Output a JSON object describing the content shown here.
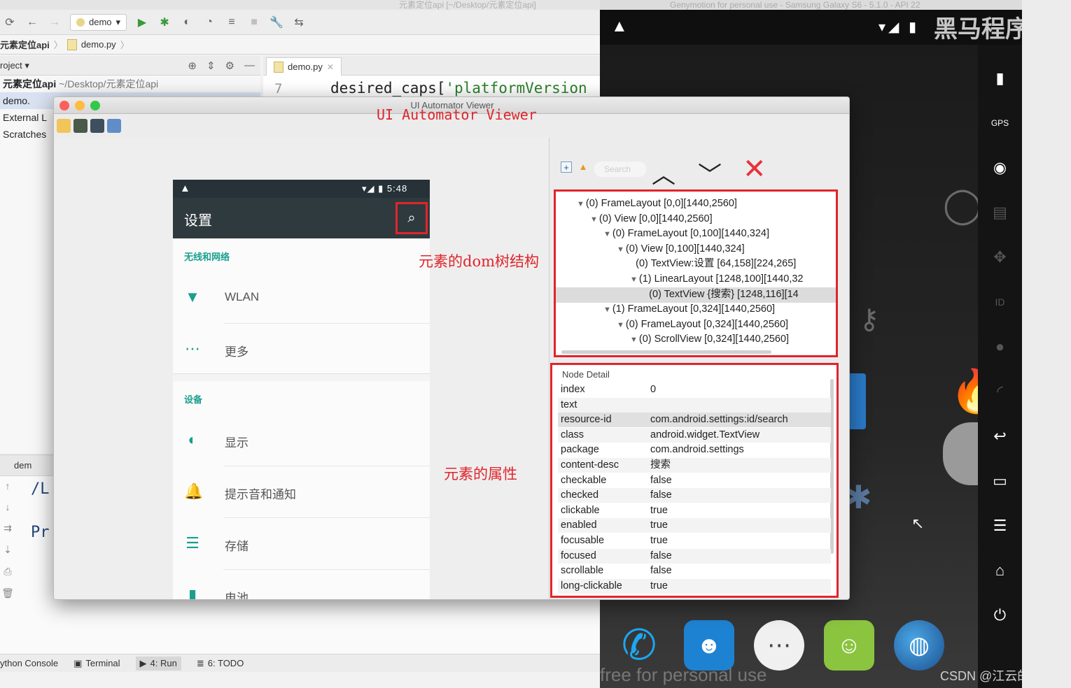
{
  "ide": {
    "title_text": "元素定位api [~/Desktop/元素定位api]",
    "run_config": "demo",
    "breadcrumb": [
      "元素定位api",
      "demo.py"
    ],
    "project_header": "roject",
    "project_rows": [
      {
        "strong": "元素定位api",
        "muted": "~/Desktop/元素定位api"
      },
      {
        "strong": "demo.",
        "muted": ""
      },
      {
        "strong": "External L",
        "muted": ""
      },
      {
        "strong": "Scratches",
        "muted": ""
      }
    ],
    "editor_tab": "demo.py",
    "line_number": "7",
    "code_prefix": "desired_caps[",
    "code_string": "'platformVersion",
    "run_tab": "dem",
    "run_lines": [
      "/L",
      "Pr"
    ],
    "status_tabs": [
      "ython Console",
      "Terminal",
      "4: Run",
      "6: TODO"
    ]
  },
  "emulator": {
    "title_text": "Genymotion for personal use - Samsung Galaxy S6 - 5.1.0 - API 22",
    "signal_text": "▾◢ ▮",
    "watermark": "黑马程序员",
    "free_text": "free for personal use",
    "csdn_text": "CSDN @江云的博客",
    "side_buttons": [
      "battery-icon",
      "gps-icon",
      "camera-icon",
      "video-icon",
      "dpad-icon",
      "id-icon",
      "identity-icon",
      "rss-icon",
      "back-icon",
      "recent-apps-icon",
      "menu-icon",
      "home-icon",
      "power-icon"
    ]
  },
  "uiav": {
    "window_title": "UI Automator Viewer",
    "search_placeholder": "Search",
    "screen": {
      "time": "5:48",
      "title": "设置",
      "category_wireless": "无线和网络",
      "category_device": "设备",
      "items_wireless": [
        "WLAN",
        "更多"
      ],
      "items_device": [
        "显示",
        "提示音和通知",
        "存储",
        "电池"
      ]
    },
    "tree": [
      {
        "indent": 0,
        "arrow": "▼",
        "text": "(0) FrameLayout [0,0][1440,2560]"
      },
      {
        "indent": 1,
        "arrow": "▼",
        "text": "(0) View [0,0][1440,2560]"
      },
      {
        "indent": 2,
        "arrow": "▼",
        "text": "(0) FrameLayout [0,100][1440,324]"
      },
      {
        "indent": 3,
        "arrow": "▼",
        "text": "(0) View [0,100][1440,324]"
      },
      {
        "indent": 4,
        "arrow": "",
        "text": "(0) TextView:设置 [64,158][224,265]"
      },
      {
        "indent": 4,
        "arrow": "▼",
        "text": "(1) LinearLayout [1248,100][1440,32"
      },
      {
        "indent": 5,
        "arrow": "",
        "text": "(0) TextView {搜索} [1248,116][14"
      },
      {
        "indent": 2,
        "arrow": "▼",
        "text": "(1) FrameLayout [0,324][1440,2560]"
      },
      {
        "indent": 3,
        "arrow": "▼",
        "text": "(0) FrameLayout [0,324][1440,2560]"
      },
      {
        "indent": 4,
        "arrow": "▼",
        "text": "(0) ScrollView [0,324][1440,2560]"
      }
    ],
    "node_detail_header": "Node Detail",
    "node_detail": [
      {
        "key": "index",
        "value": "0"
      },
      {
        "key": "text",
        "value": ""
      },
      {
        "key": "resource-id",
        "value": "com.android.settings:id/search"
      },
      {
        "key": "class",
        "value": "android.widget.TextView"
      },
      {
        "key": "package",
        "value": "com.android.settings"
      },
      {
        "key": "content-desc",
        "value": "搜索"
      },
      {
        "key": "checkable",
        "value": "false"
      },
      {
        "key": "checked",
        "value": "false"
      },
      {
        "key": "clickable",
        "value": "true"
      },
      {
        "key": "enabled",
        "value": "true"
      },
      {
        "key": "focusable",
        "value": "true"
      },
      {
        "key": "focused",
        "value": "false"
      },
      {
        "key": "scrollable",
        "value": "false"
      },
      {
        "key": "long-clickable",
        "value": "true"
      }
    ]
  },
  "annotations": {
    "title_label": "UI Automator Viewer",
    "dom_label": "元素的dom树结构",
    "attr_label": "元素的属性"
  },
  "colors": {
    "annotation_red": "#e0252b",
    "settings_teal": "#1a9f8e",
    "actionbar": "#2f3a3f"
  }
}
